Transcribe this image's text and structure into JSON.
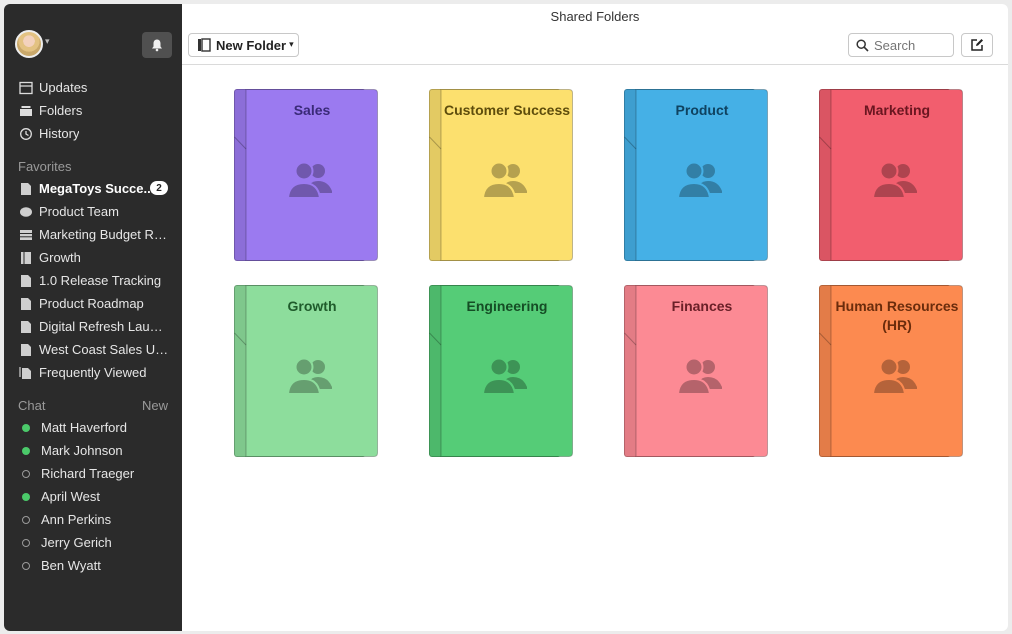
{
  "window": {
    "title": "Shared Folders"
  },
  "sidebar": {
    "nav": [
      {
        "label": "Updates",
        "icon": "updates-icon"
      },
      {
        "label": "Folders",
        "icon": "folders-icon"
      },
      {
        "label": "History",
        "icon": "history-icon"
      }
    ],
    "favorites_heading": "Favorites",
    "favorites": [
      {
        "label": "MegaToys Succe...",
        "icon": "document-icon",
        "badge": "2",
        "active": true
      },
      {
        "label": "Product Team",
        "icon": "chat-bubble-icon"
      },
      {
        "label": "Marketing Budget Re...",
        "icon": "table-icon"
      },
      {
        "label": "Growth",
        "icon": "notebook-icon"
      },
      {
        "label": "1.0 Release Tracking",
        "icon": "document-icon"
      },
      {
        "label": "Product Roadmap",
        "icon": "document-icon"
      },
      {
        "label": "Digital Refresh Launc...",
        "icon": "document-icon"
      },
      {
        "label": "West Coast Sales Upd...",
        "icon": "document-icon"
      },
      {
        "label": "Frequently Viewed",
        "icon": "documents-stack-icon"
      }
    ],
    "chat_heading": "Chat",
    "chat_new_label": "New",
    "chat": [
      {
        "name": "Matt Haverford",
        "online": true
      },
      {
        "name": "Mark Johnson",
        "online": true
      },
      {
        "name": "Richard Traeger",
        "online": false
      },
      {
        "name": "April West",
        "online": true
      },
      {
        "name": "Ann Perkins",
        "online": false
      },
      {
        "name": "Jerry Gerich",
        "online": false
      },
      {
        "name": "Ben Wyatt",
        "online": false
      }
    ]
  },
  "toolbar": {
    "new_folder_label": "New Folder",
    "search_placeholder": "Search"
  },
  "folders": [
    {
      "name": "Sales",
      "color": "#9b7af0",
      "text": "#3a2a78"
    },
    {
      "name": "Customer Success",
      "color": "#fce06e",
      "text": "#5e4d0c"
    },
    {
      "name": "Product",
      "color": "#45b0e6",
      "text": "#0f4260"
    },
    {
      "name": "Marketing",
      "color": "#f25e6e",
      "text": "#6a1620"
    },
    {
      "name": "Growth",
      "color": "#8ddd9c",
      "text": "#1f5b2b"
    },
    {
      "name": "Engineering",
      "color": "#55cc77",
      "text": "#154d25"
    },
    {
      "name": "Finances",
      "color": "#fc8a94",
      "text": "#6a2028"
    },
    {
      "name": "Human Resources (HR)",
      "color": "#fc8a50",
      "text": "#6a2c0c"
    }
  ]
}
